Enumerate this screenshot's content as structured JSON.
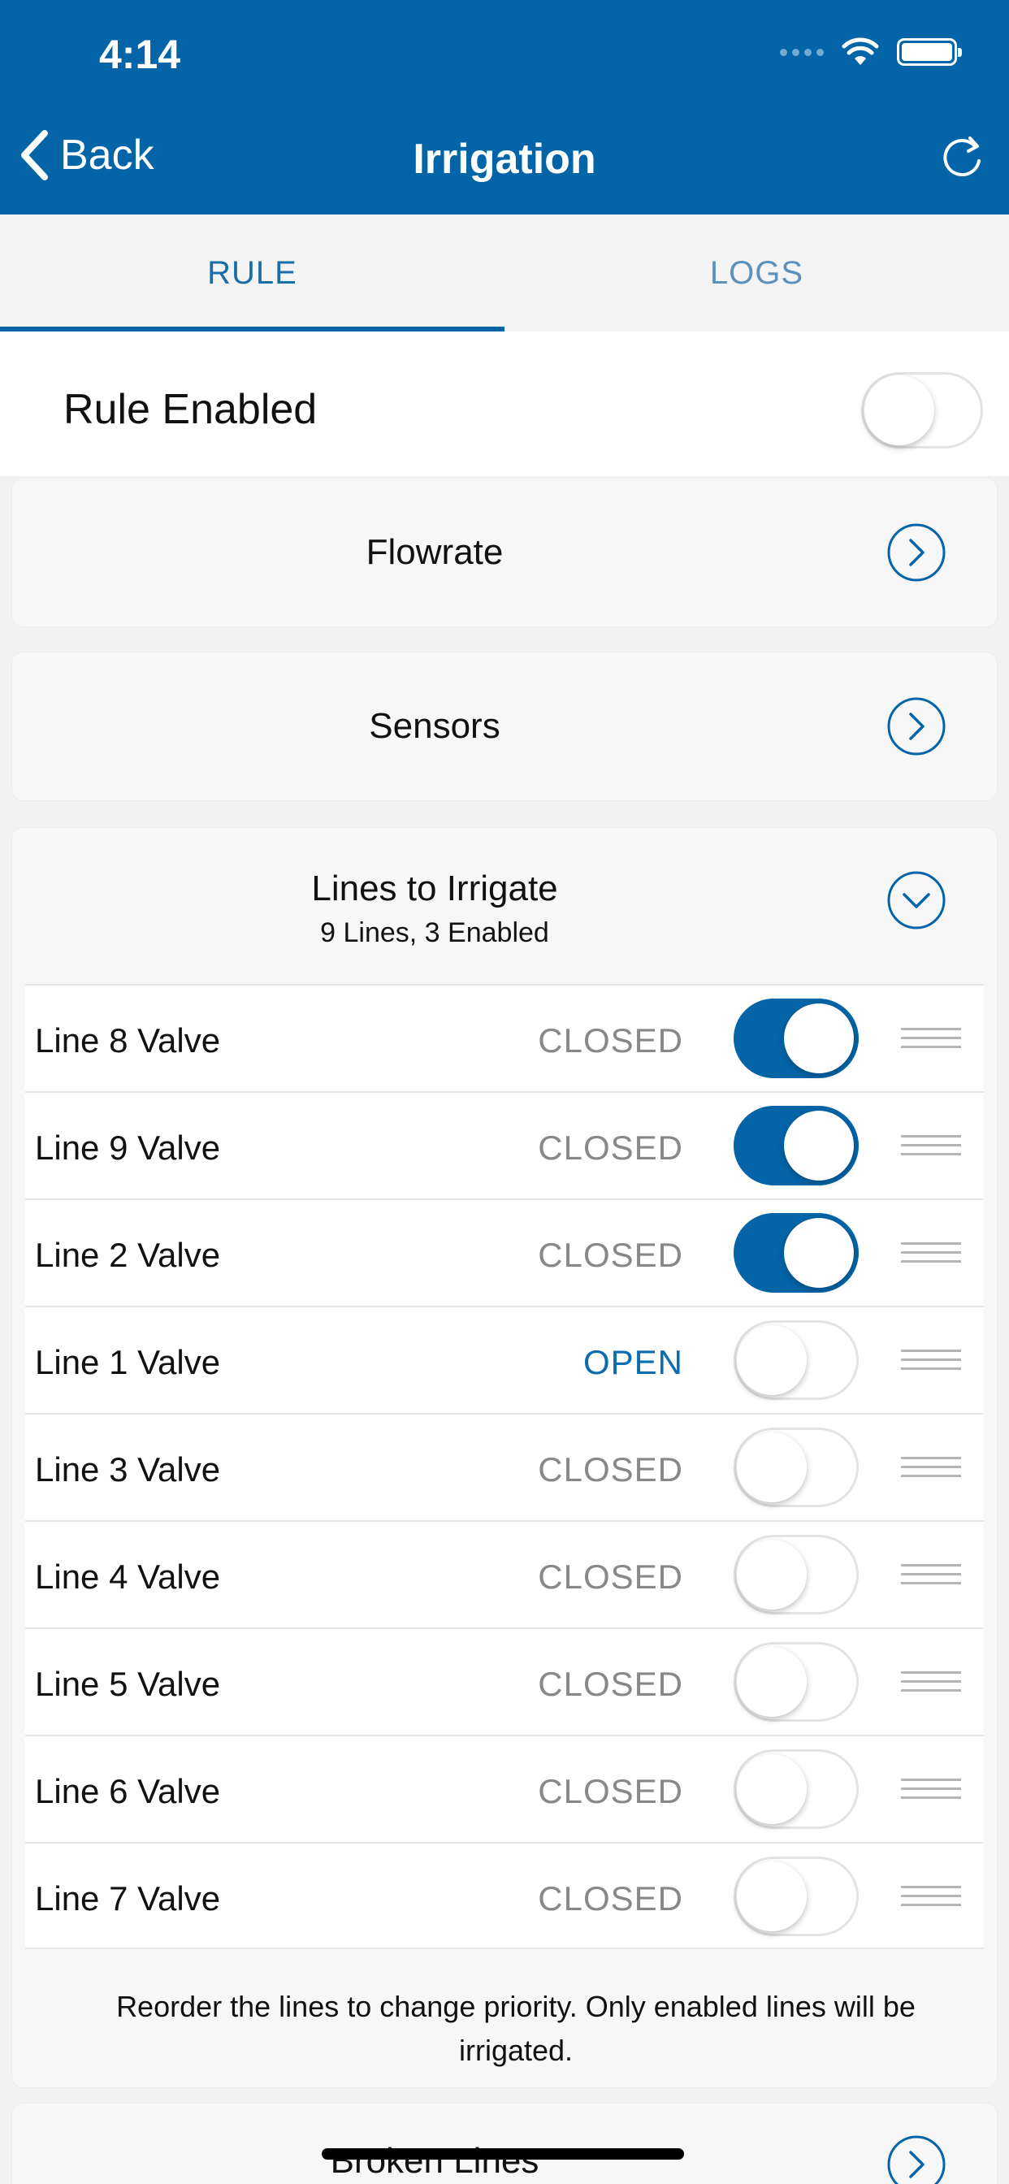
{
  "status_bar": {
    "time": "4:14"
  },
  "nav": {
    "back_label": "Back",
    "title": "Irrigation"
  },
  "tabs": [
    {
      "label": "RULE",
      "active": true
    },
    {
      "label": "LOGS",
      "active": false
    }
  ],
  "rule": {
    "label": "Rule Enabled",
    "enabled": false
  },
  "sections": {
    "flowrate": {
      "title": "Flowrate"
    },
    "sensors": {
      "title": "Sensors"
    },
    "lines": {
      "title": "Lines to Irrigate",
      "subtitle": "9 Lines, 3 Enabled",
      "items": [
        {
          "name": "Line 8 Valve",
          "status": "CLOSED",
          "enabled": true
        },
        {
          "name": "Line 9 Valve",
          "status": "CLOSED",
          "enabled": true
        },
        {
          "name": "Line 2 Valve",
          "status": "CLOSED",
          "enabled": true
        },
        {
          "name": "Line 1 Valve",
          "status": "OPEN",
          "enabled": false
        },
        {
          "name": "Line 3 Valve",
          "status": "CLOSED",
          "enabled": false
        },
        {
          "name": "Line 4 Valve",
          "status": "CLOSED",
          "enabled": false
        },
        {
          "name": "Line 5 Valve",
          "status": "CLOSED",
          "enabled": false
        },
        {
          "name": "Line 6 Valve",
          "status": "CLOSED",
          "enabled": false
        },
        {
          "name": "Line 7 Valve",
          "status": "CLOSED",
          "enabled": false
        }
      ],
      "footnote": "Reorder the lines to change priority. Only enabled lines will be irrigated."
    },
    "broken_lines": {
      "title": "Broken Lines"
    }
  },
  "colors": {
    "accent": "#0364a8",
    "open_status": "#0b6cb0",
    "closed_status": "#888888"
  }
}
